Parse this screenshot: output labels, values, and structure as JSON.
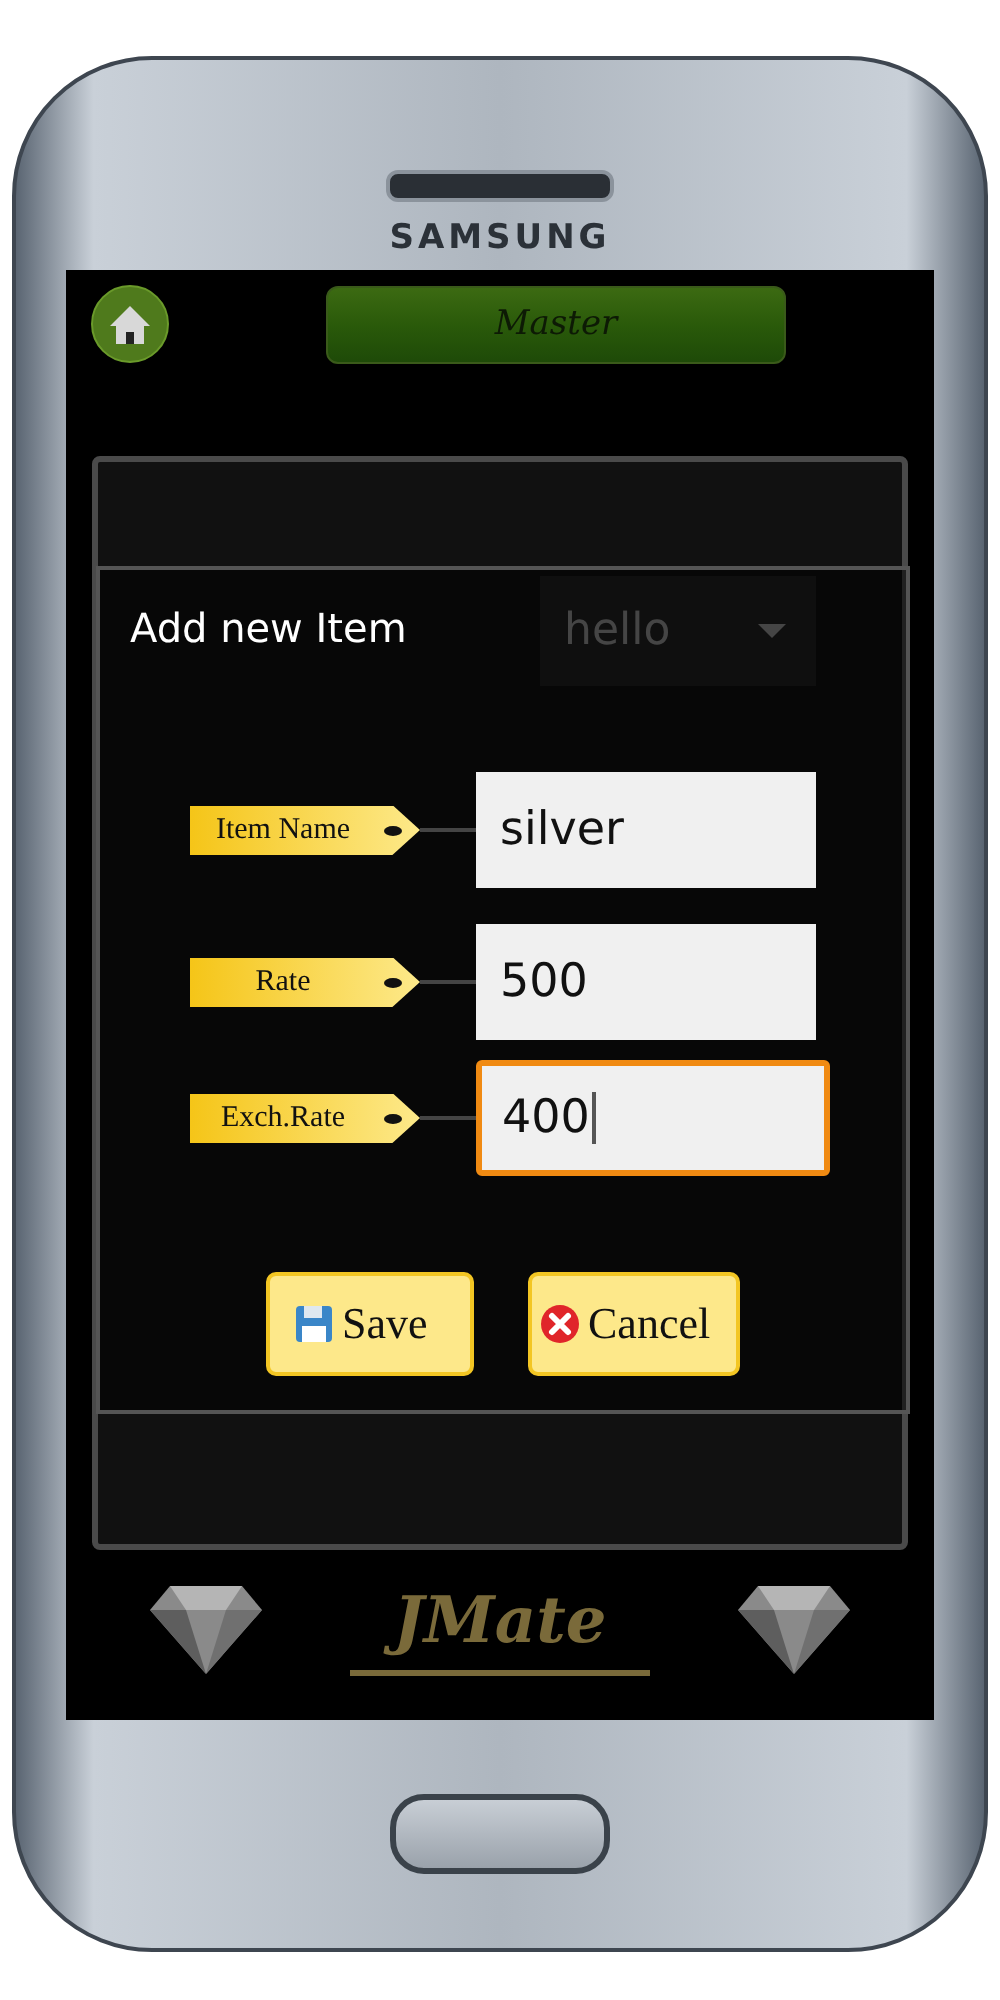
{
  "device": {
    "brand": "SAMSUNG"
  },
  "header": {
    "title": "Master"
  },
  "background": {
    "dropdown_value": "hello"
  },
  "dialog": {
    "title": "Add new Item",
    "fields": [
      {
        "label": "Item Name",
        "value": "silver",
        "focused": false
      },
      {
        "label": "Rate",
        "value": "500",
        "focused": false
      },
      {
        "label": "Exch.Rate",
        "value": "400",
        "focused": true
      }
    ],
    "buttons": [
      {
        "label": "Save",
        "kind": "save"
      },
      {
        "label": "Cancel",
        "kind": "cancel"
      }
    ]
  },
  "footer": {
    "brand": "JMate"
  }
}
